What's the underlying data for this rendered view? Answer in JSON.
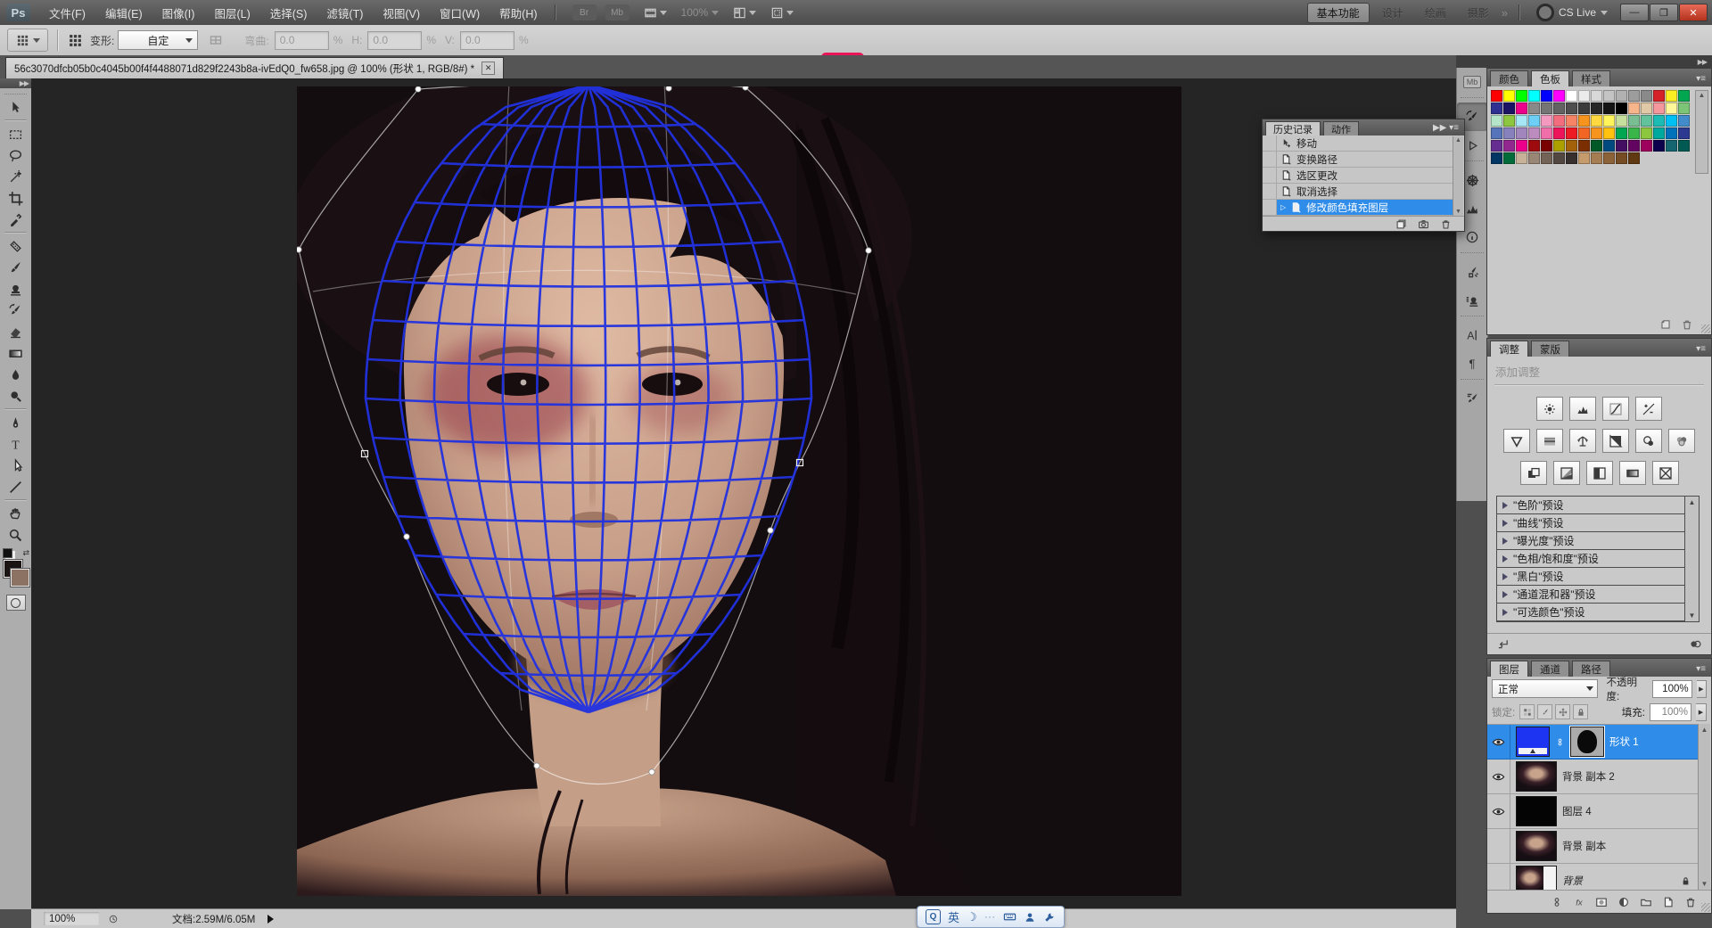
{
  "titlebar": {
    "logo": "Ps",
    "menus": [
      "文件(F)",
      "编辑(E)",
      "图像(I)",
      "图层(L)",
      "选择(S)",
      "滤镜(T)",
      "视图(V)",
      "窗口(W)",
      "帮助(H)"
    ],
    "doc_buttons": [
      "Br",
      "Mb"
    ],
    "zoom_dropdown": "100%",
    "workspaces": {
      "items": [
        "基本功能",
        "设计",
        "绘画",
        "摄影"
      ],
      "active": "基本功能",
      "overflow": "»"
    },
    "cs_live_label": "CS Live",
    "window_controls": {
      "minimize": "—",
      "restore": "❐",
      "close": "✕"
    }
  },
  "options_bar": {
    "transform_label": "变形:",
    "transform_value": "自定",
    "bend_label": "弯曲:",
    "bend_value": "0.0",
    "h_label": "H:",
    "h_value": "0.0",
    "v_label": "V:",
    "v_value": "0.0",
    "percent": "%",
    "highlight_color": "#ea1558"
  },
  "document_tab": {
    "title": "56c3070dfcb05b0c4045b00f4f4488071d829f2243b8a-ivEdQ0_fw658.jpg @ 100% (形状 1, RGB/8#) *",
    "close": "✕"
  },
  "toolbox": {
    "tools": [
      "move",
      "sep",
      "marquee",
      "lasso",
      "quickselect",
      "crop",
      "eyedropper",
      "sep",
      "healing",
      "brush",
      "stamp",
      "historybrush",
      "eraser",
      "gradient",
      "blur",
      "dodge",
      "sep",
      "pen",
      "type",
      "pathselect",
      "line",
      "sep",
      "hand",
      "zoom"
    ],
    "foreground_color": "#1a1412",
    "background_color": "#8b7262"
  },
  "dock_strip": {
    "icons": [
      "mb",
      "sep",
      "history-pressed",
      "actions",
      "sep",
      "navigator",
      "histogram",
      "info",
      "sep",
      "brushpanel",
      "clonesource",
      "sep",
      "character",
      "paragraph",
      "sep",
      "brushes2"
    ]
  },
  "history_panel": {
    "tabs": [
      "历史记录",
      "动作"
    ],
    "active_tab": "历史记录",
    "items": [
      {
        "label": "移动",
        "icon": "move"
      },
      {
        "label": "变换路径",
        "icon": "page"
      },
      {
        "label": "选区更改",
        "icon": "page"
      },
      {
        "label": "取消选择",
        "icon": "page"
      },
      {
        "label": "修改颜色填充图层",
        "icon": "page",
        "selected": true
      }
    ]
  },
  "swatches_panel": {
    "tabs": [
      "颜色",
      "色板",
      "样式"
    ],
    "active_tab": "色板",
    "colors": [
      "#ff0000",
      "#ffff00",
      "#00ff00",
      "#00ffff",
      "#0000ff",
      "#ff00ff",
      "#ffffff",
      "#ebebeb",
      "#d8d8d8",
      "#c4c4c4",
      "#b1b1b1",
      "#9d9d9d",
      "#8a8a8a",
      "#d62128",
      "#fbee23",
      "#00a650",
      "#2e3192",
      "#1b1464",
      "#ec008c",
      "#898989",
      "#757575",
      "#626262",
      "#4e4e4e",
      "#3b3b3b",
      "#272727",
      "#141414",
      "#000000",
      "#f7b58c",
      "#e0c9a6",
      "#f5989d",
      "#fff799",
      "#7cc576",
      "#b5e5c8",
      "#8dc63f",
      "#a6e7f5",
      "#6dcff6",
      "#f49ac1",
      "#f26d7d",
      "#f58466",
      "#f7941d",
      "#ffd93f",
      "#fff45c",
      "#c6df9c",
      "#79bd92",
      "#61c29c",
      "#1cbbb4",
      "#00bff3",
      "#438ccb",
      "#5674b9",
      "#8781bd",
      "#a186be",
      "#bd8cbf",
      "#f06eaa",
      "#ed145b",
      "#ed1c24",
      "#f26522",
      "#f7941d",
      "#ffc20e",
      "#00a651",
      "#39b54a",
      "#8dc63f",
      "#00a99d",
      "#0072bc",
      "#2b3990",
      "#662d91",
      "#92278f",
      "#ec008c",
      "#9e0b0f",
      "#790000",
      "#aba000",
      "#a36209",
      "#7b2e00",
      "#005826",
      "#004a80",
      "#440e62",
      "#630460",
      "#9e005d",
      "#0d004c",
      "#156570",
      "#005952",
      "#003663",
      "#016c3a",
      "#c7b299",
      "#998675",
      "#736357",
      "#534741",
      "#362f2d",
      "#c69c6d",
      "#a67c52",
      "#8c6239",
      "#754c24",
      "#603913"
    ]
  },
  "adjustments_panel": {
    "tabs": [
      "调整",
      "蒙版"
    ],
    "active_tab": "调整",
    "hint": "添加调整",
    "icon_rows": [
      [
        "sun",
        "histo2",
        "curves",
        "expo"
      ],
      [
        "vib",
        "hslbars",
        "scales",
        "bwsplit",
        "photofilter",
        "mixer"
      ],
      [
        "invertsq",
        "poster",
        "threshold",
        "gradmap",
        "selx"
      ]
    ],
    "presets": [
      "\"色阶\"预设",
      "\"曲线\"预设",
      "\"曝光度\"预设",
      "\"色相/饱和度\"预设",
      "\"黑白\"预设",
      "\"通道混和器\"预设",
      "\"可选颜色\"预设"
    ]
  },
  "layers_panel": {
    "tabs": [
      "图层",
      "通道",
      "路径"
    ],
    "active_tab": "图层",
    "blend_mode": "正常",
    "opacity_label": "不透明度:",
    "opacity_value": "100%",
    "lock_label": "锁定:",
    "lock_icons": [
      "locktrans",
      "lockpix",
      "lockpos",
      "lockall"
    ],
    "fill_label": "填充:",
    "fill_value": "100%",
    "layers": [
      {
        "name": "形状 1",
        "visible": true,
        "selected": true,
        "thumb": "blue-fill",
        "mask": true,
        "linked": true
      },
      {
        "name": "背景 副本 2",
        "visible": true,
        "thumb": "photo"
      },
      {
        "name": "图层 4",
        "visible": true,
        "thumb": "black"
      },
      {
        "name": "背景 副本",
        "visible": false,
        "thumb": "photo"
      },
      {
        "name": "背景",
        "visible": false,
        "thumb": "photo-bg",
        "locked": true,
        "italic": true
      }
    ]
  },
  "status_bar": {
    "zoom": "100%",
    "doc_info": "文档:2.59M/6.05M"
  },
  "ime_bar": {
    "lang": "英",
    "q": "Q",
    "moon": "☽",
    "dots": "⋯"
  }
}
